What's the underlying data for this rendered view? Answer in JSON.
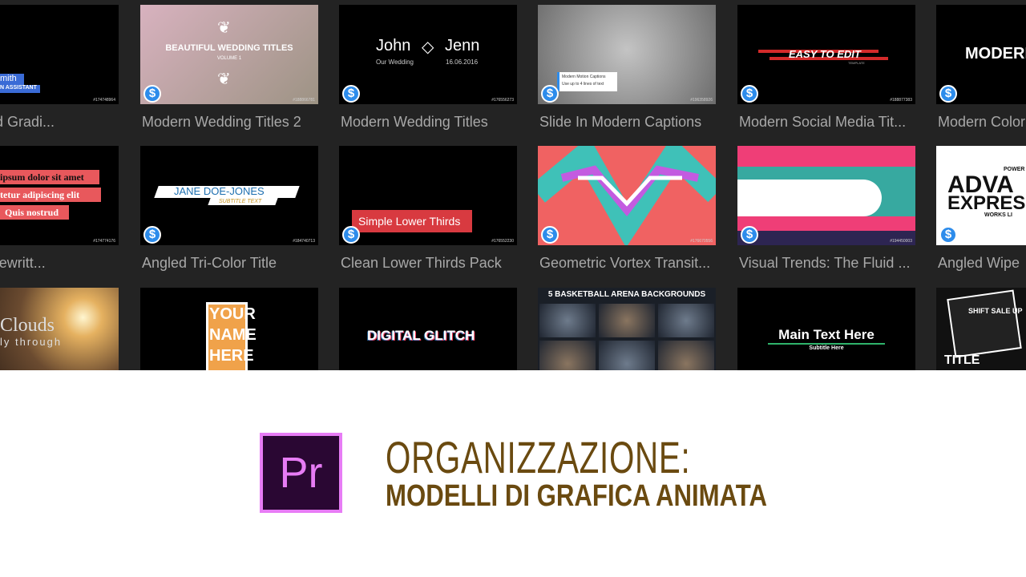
{
  "cards": [
    {
      "label": "Animated Gradi...",
      "id": "#174748964",
      "lines": [
        "mith",
        "N ASSISTANT"
      ]
    },
    {
      "label": "Modern Wedding Titles 2",
      "id": "#188866781",
      "lines": [
        "BEAUTIFUL WEDDING TITLES",
        "VOLUME 1"
      ]
    },
    {
      "label": "Modern Wedding Titles",
      "id": "#176556273",
      "lines": [
        "John",
        "Jenn",
        "Our Wedding",
        "16.06.2016"
      ]
    },
    {
      "label": "Slide In Modern Captions",
      "id": "#196358926",
      "lines": [
        "Modern Motion Captions",
        "Use up to 4 lines of text"
      ]
    },
    {
      "label": "Modern Social Media Tit...",
      "id": "#188877383",
      "lines": [
        "EASY TO EDIT",
        "TEMPLATE"
      ]
    },
    {
      "label": "Modern Color",
      "id": "",
      "lines": [
        "MODERN"
      ]
    },
    {
      "label": "izing Typewritt...",
      "id": "#174774176",
      "lines": [
        "ipsum dolor sit amet",
        "tetur adipiscing elit",
        "Quis nostrud"
      ]
    },
    {
      "label": "Angled Tri-Color Title",
      "id": "#184740713",
      "lines": [
        "JANE DOE-JONES",
        "SUBTITLE TEXT"
      ]
    },
    {
      "label": "Clean Lower Thirds Pack",
      "id": "#176552230",
      "lines": [
        "Simple Lower Thirds"
      ]
    },
    {
      "label": "Geometric Vortex Transit...",
      "id": "#176670556",
      "lines": []
    },
    {
      "label": "Visual Trends: The Fluid ...",
      "id": "#194450003",
      "lines": []
    },
    {
      "label": "Angled Wipe",
      "id": "",
      "lines": [
        "POWER",
        "ADVA",
        "EXPRES",
        "WORKS LI"
      ]
    },
    {
      "label": "",
      "id": "",
      "lines": [
        "Clouds",
        "ly through"
      ]
    },
    {
      "label": "",
      "id": "",
      "lines": [
        "YOUR",
        "NAME",
        "HERE"
      ]
    },
    {
      "label": "",
      "id": "",
      "lines": [
        "DIGITAL GLITCH"
      ]
    },
    {
      "label": "",
      "id": "",
      "lines": [
        "5 BASKETBALL ARENA BACKGROUNDS"
      ]
    },
    {
      "label": "",
      "id": "",
      "lines": [
        "Main Text Here",
        "Subtitle Here"
      ]
    },
    {
      "label": "",
      "id": "",
      "lines": [
        "SHIFT SALE UP",
        "TITLE"
      ]
    }
  ],
  "brand": {
    "logo_text": "Pr",
    "logo_border": "#e77cf5",
    "logo_bg": "#2a0733",
    "title_color": "#6a4a10"
  },
  "heading": {
    "line1": "ORGANIZZAZIONE:",
    "line2": "MODELLI DI GRAFICA ANIMATA"
  },
  "icons": {
    "price": "dollar-icon"
  }
}
